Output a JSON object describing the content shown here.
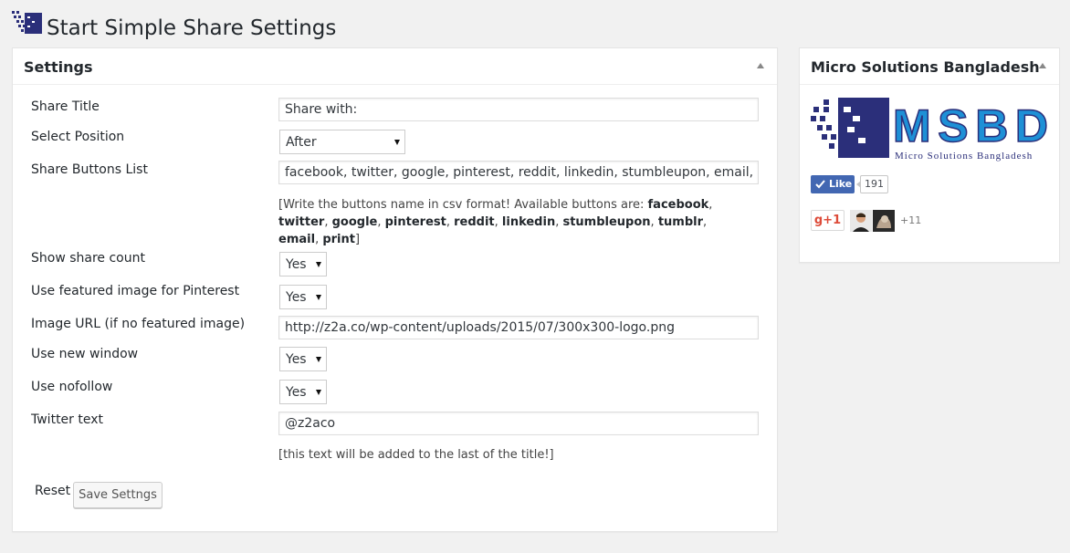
{
  "page": {
    "title": "Start Simple Share Settings",
    "title_icon": "plugin-grid-icon"
  },
  "settings_box": {
    "title": "Settings",
    "fields": {
      "share_title": {
        "label": "Share Title",
        "value": "Share with:"
      },
      "select_position": {
        "label": "Select Position",
        "value": "After"
      },
      "share_buttons": {
        "label": "Share Buttons List",
        "value": "facebook, twitter, google, pinterest, reddit, linkedin, stumbleupon, email, print",
        "help_prefix": "[Write the buttons name in csv format! Available buttons are: ",
        "help_buttons": [
          "facebook",
          "twitter",
          "google",
          "pinterest",
          "reddit",
          "linkedin",
          "stumbleupon",
          "tumblr",
          "email",
          "print"
        ],
        "help_separator": ", ",
        "help_suffix": "]"
      },
      "show_share_count": {
        "label": "Show share count",
        "value": "Yes"
      },
      "featured_pinterest": {
        "label": "Use featured image for Pinterest",
        "value": "Yes"
      },
      "image_url": {
        "label": "Image URL (if no featured image)",
        "value": "http://z2a.co/wp-content/uploads/2015/07/300x300-logo.png"
      },
      "new_window": {
        "label": "Use new window",
        "value": "Yes"
      },
      "nofollow": {
        "label": "Use nofollow",
        "value": "Yes"
      },
      "twitter_text": {
        "label": "Twitter text",
        "value": "@z2aco",
        "help": "[this text will be added to the last of the title!]"
      }
    },
    "reset_label": "Reset",
    "save_label": "Save Settngs"
  },
  "sidebar_box": {
    "title": "Micro Solutions Bangladesh",
    "logo": {
      "text": "MSBD",
      "tagline": "Micro Solutions Bangladesh"
    },
    "like_label": "Like",
    "like_count": "191",
    "gplus_label": "g+1",
    "plus_count": "+11"
  },
  "colors": {
    "background": "#f1f1f1",
    "brand_navy": "#2b2f7a",
    "brand_blue": "#1e90d6",
    "facebook": "#4267b2",
    "gplus": "#dd4b39"
  }
}
